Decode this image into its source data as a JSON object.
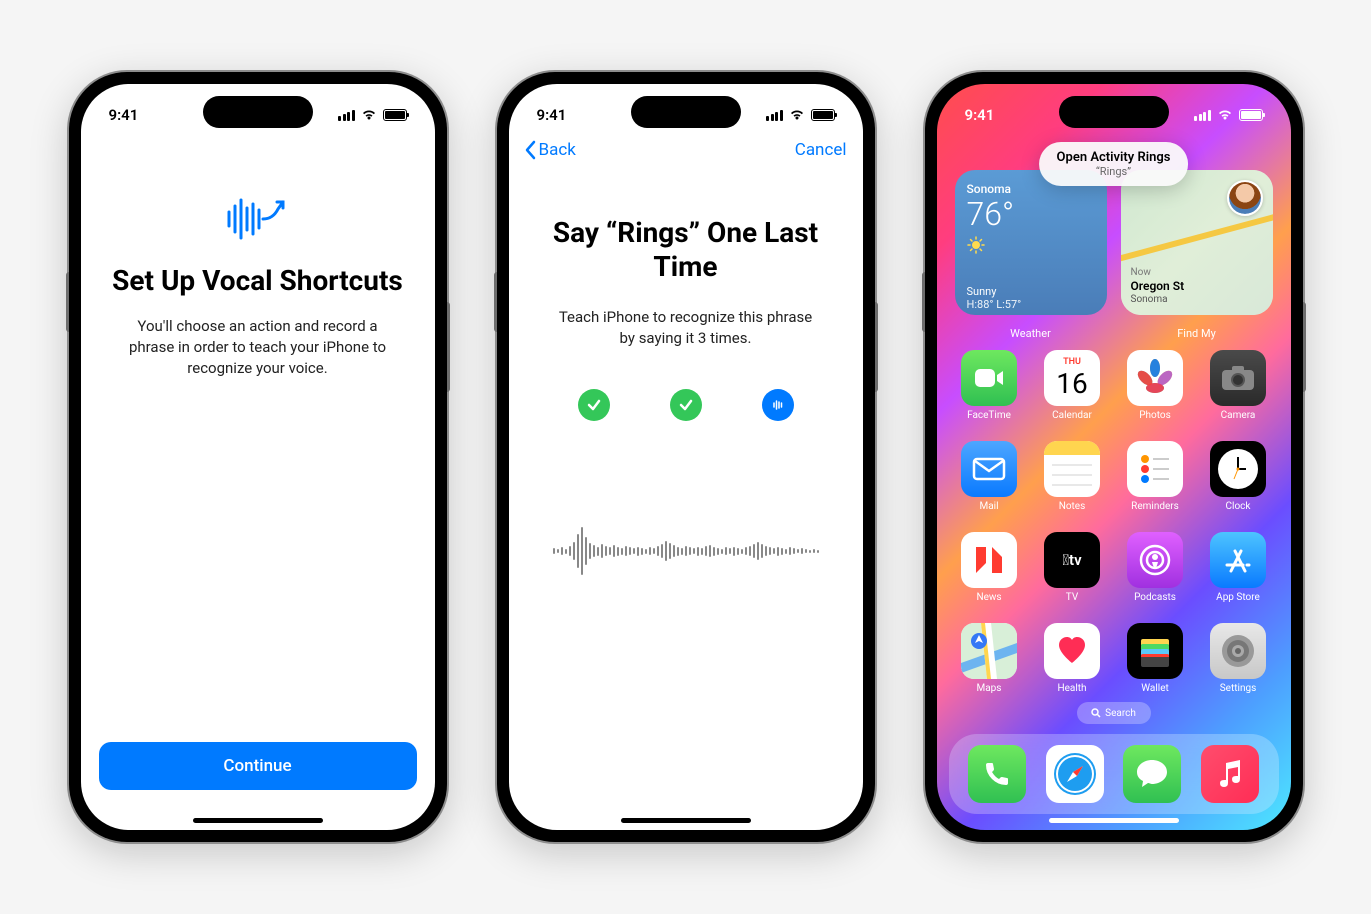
{
  "status": {
    "time": "9:41"
  },
  "screen1": {
    "title": "Set Up Vocal Shortcuts",
    "description": "You'll choose an action and record a phrase in order to teach your iPhone to recognize your voice.",
    "continue": "Continue"
  },
  "screen2": {
    "back": "Back",
    "cancel": "Cancel",
    "title": "Say “Rings” One Last Time",
    "description": "Teach iPhone to recognize this phrase by saying it 3 times."
  },
  "screen3": {
    "notification": {
      "title": "Open Activity Rings",
      "subtitle": "“Rings”"
    },
    "weather": {
      "location": "Sonoma",
      "temp": "76°",
      "condition": "Sunny",
      "hilo": "H:88° L:57°",
      "label": "Weather"
    },
    "findmy": {
      "now": "Now",
      "place": "Oregon St",
      "city": "Sonoma",
      "label": "Find My"
    },
    "calendar": {
      "day": "THU",
      "date": "16"
    },
    "apps": {
      "facetime": "FaceTime",
      "calendar": "Calendar",
      "photos": "Photos",
      "camera": "Camera",
      "mail": "Mail",
      "notes": "Notes",
      "reminders": "Reminders",
      "clock": "Clock",
      "news": "News",
      "tv": "TV",
      "podcasts": "Podcasts",
      "appstore": "App Store",
      "maps": "Maps",
      "health": "Health",
      "wallet": "Wallet",
      "settings": "Settings"
    },
    "search": "Search"
  }
}
